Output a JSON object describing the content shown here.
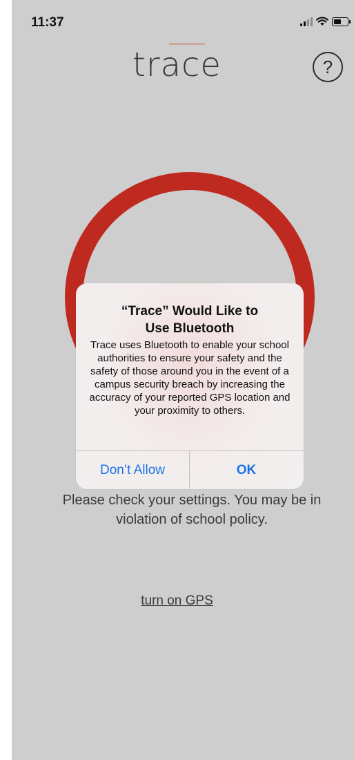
{
  "status_bar": {
    "time": "11:37"
  },
  "header": {
    "logo": "trace",
    "help_glyph": "?"
  },
  "colors": {
    "ring": "#be2a1f",
    "background": "#cecece",
    "link_blue": "#1a72e8"
  },
  "alert": {
    "title_line1": "“Trace” Would Like to",
    "title_line2": "Use Bluetooth",
    "message": "Trace uses Bluetooth to enable your school authorities to ensure your safety and the safety of those around you in the event of a campus security breach by increasing the accuracy of your reported GPS location and your proximity to others.",
    "deny_label": "Don’t Allow",
    "ok_label": "OK"
  },
  "main": {
    "warning": "Please check your settings. You may be in violation of school policy.",
    "gps_link": "turn on GPS"
  }
}
